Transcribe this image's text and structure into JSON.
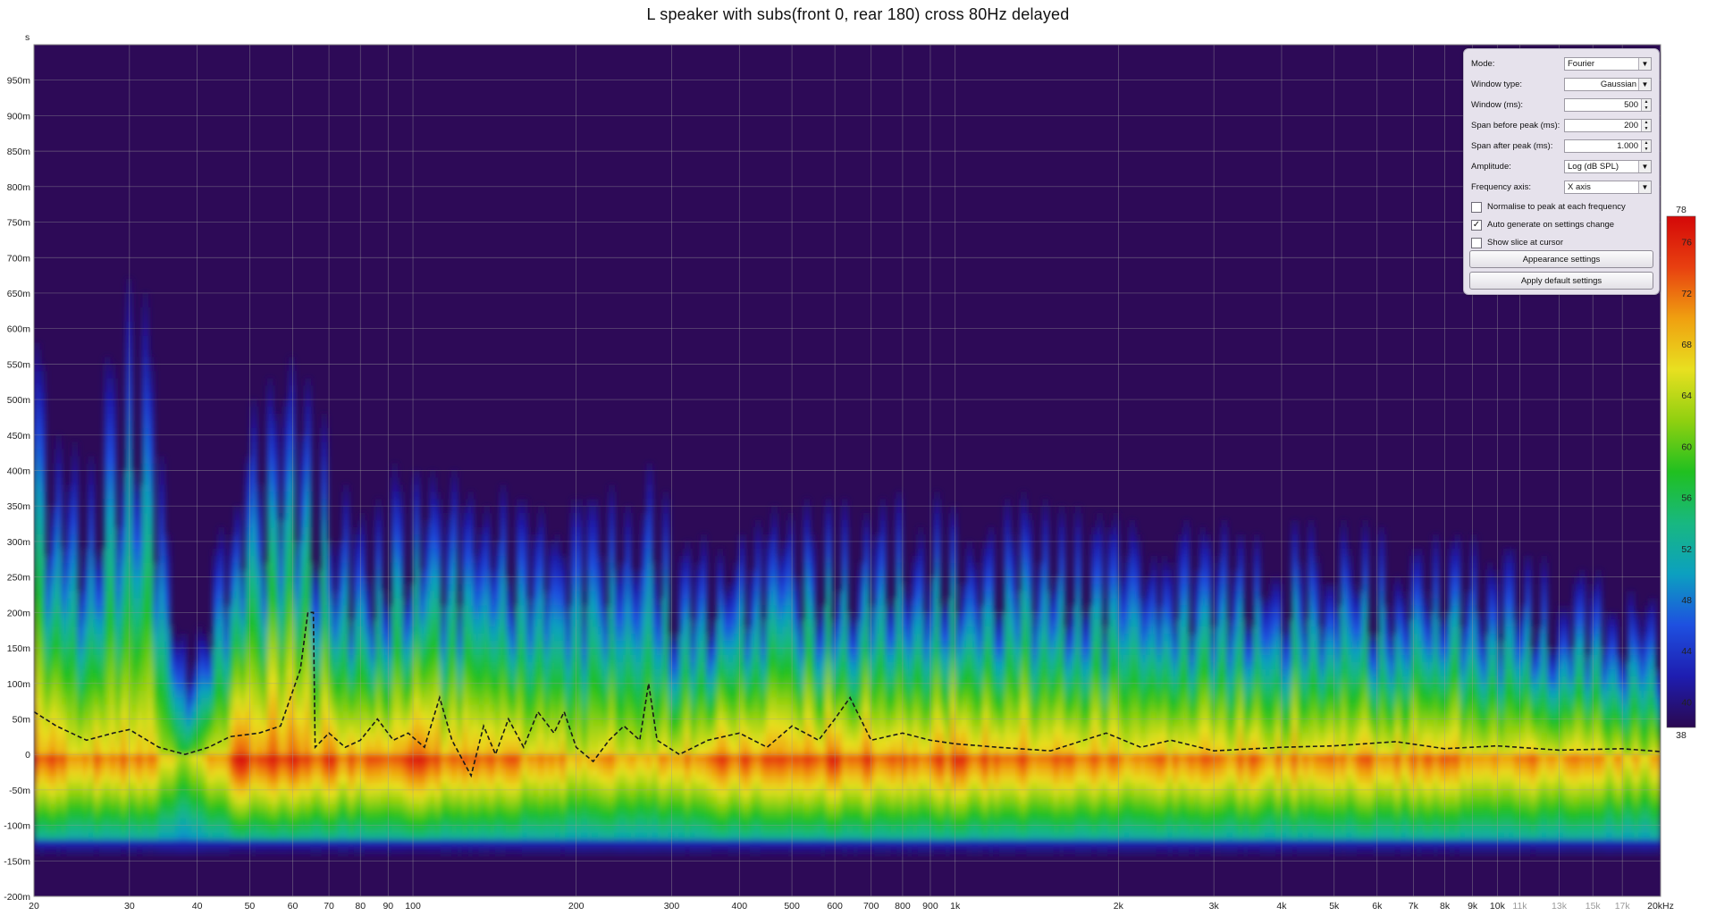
{
  "chart_data": {
    "type": "heatmap",
    "title": "L speaker with subs(front 0, rear 180) cross 80Hz delayed",
    "x_scale": "log",
    "xlim": [
      20,
      20000
    ],
    "x_ticks": [
      {
        "v": 20,
        "label": "20"
      },
      {
        "v": 30,
        "label": "30"
      },
      {
        "v": 40,
        "label": "40"
      },
      {
        "v": 50,
        "label": "50"
      },
      {
        "v": 60,
        "label": "60"
      },
      {
        "v": 70,
        "label": "70"
      },
      {
        "v": 80,
        "label": "80"
      },
      {
        "v": 90,
        "label": "90"
      },
      {
        "v": 100,
        "label": "100"
      },
      {
        "v": 200,
        "label": "200"
      },
      {
        "v": 300,
        "label": "300"
      },
      {
        "v": 400,
        "label": "400"
      },
      {
        "v": 500,
        "label": "500"
      },
      {
        "v": 600,
        "label": "600"
      },
      {
        "v": 700,
        "label": "700"
      },
      {
        "v": 800,
        "label": "800"
      },
      {
        "v": 900,
        "label": "900"
      },
      {
        "v": 1000,
        "label": "1k"
      },
      {
        "v": 2000,
        "label": "2k"
      },
      {
        "v": 3000,
        "label": "3k"
      },
      {
        "v": 4000,
        "label": "4k"
      },
      {
        "v": 5000,
        "label": "5k"
      },
      {
        "v": 6000,
        "label": "6k"
      },
      {
        "v": 7000,
        "label": "7k"
      },
      {
        "v": 8000,
        "label": "8k"
      },
      {
        "v": 9000,
        "label": "9k"
      },
      {
        "v": 10000,
        "label": "10k"
      },
      {
        "v": 11000,
        "label": "11k",
        "dim": true
      },
      {
        "v": 13000,
        "label": "13k",
        "dim": true
      },
      {
        "v": 15000,
        "label": "15k",
        "dim": true
      },
      {
        "v": 17000,
        "label": "17k",
        "dim": true
      },
      {
        "v": 20000,
        "label": "20kHz"
      }
    ],
    "ylabel": "s",
    "ylim": [
      -0.2,
      1.0
    ],
    "y_ticks": [
      {
        "v": 0.95,
        "label": "950m"
      },
      {
        "v": 0.9,
        "label": "900m"
      },
      {
        "v": 0.85,
        "label": "850m"
      },
      {
        "v": 0.8,
        "label": "800m"
      },
      {
        "v": 0.75,
        "label": "750m"
      },
      {
        "v": 0.7,
        "label": "700m"
      },
      {
        "v": 0.65,
        "label": "650m"
      },
      {
        "v": 0.6,
        "label": "600m"
      },
      {
        "v": 0.55,
        "label": "550m"
      },
      {
        "v": 0.5,
        "label": "500m"
      },
      {
        "v": 0.45,
        "label": "450m"
      },
      {
        "v": 0.4,
        "label": "400m"
      },
      {
        "v": 0.35,
        "label": "350m"
      },
      {
        "v": 0.3,
        "label": "300m"
      },
      {
        "v": 0.25,
        "label": "250m"
      },
      {
        "v": 0.2,
        "label": "200m"
      },
      {
        "v": 0.15,
        "label": "150m"
      },
      {
        "v": 0.1,
        "label": "100m"
      },
      {
        "v": 0.05,
        "label": "50m"
      },
      {
        "v": 0,
        "label": "0"
      },
      {
        "v": -0.05,
        "label": "-50m"
      },
      {
        "v": -0.1,
        "label": "-100m"
      },
      {
        "v": -0.15,
        "label": "-150m"
      },
      {
        "v": -0.2,
        "label": "-200m"
      }
    ],
    "color_scale": {
      "min": 38,
      "max": 78,
      "labels": [
        {
          "v": 78,
          "label": "78"
        },
        {
          "v": 76,
          "label": "76"
        },
        {
          "v": 72,
          "label": "72"
        },
        {
          "v": 68,
          "label": "68"
        },
        {
          "v": 64,
          "label": "64"
        },
        {
          "v": 60,
          "label": "60"
        },
        {
          "v": 56,
          "label": "56"
        },
        {
          "v": 52,
          "label": "52"
        },
        {
          "v": 48,
          "label": "48"
        },
        {
          "v": 44,
          "label": "44"
        },
        {
          "v": 40,
          "label": "40"
        },
        {
          "v": 38,
          "label": "38"
        }
      ],
      "colors": [
        "#2a0850",
        "#1e1db0",
        "#1e50e0",
        "#0ca0c0",
        "#18b880",
        "#20c020",
        "#90d010",
        "#e8e020",
        "#f0a010",
        "#e84010",
        "#d40808"
      ]
    },
    "background_color": "#2d0a57",
    "grid": true,
    "decay_envelope": [
      {
        "f": 20,
        "t": 0.55,
        "a": 70
      },
      {
        "f": 24,
        "t": 0.38,
        "a": 68
      },
      {
        "f": 31,
        "t": 0.68,
        "a": 68
      },
      {
        "f": 38,
        "t": 0.1,
        "a": 60
      },
      {
        "f": 48,
        "t": 0.45,
        "a": 72
      },
      {
        "f": 62,
        "t": 0.52,
        "a": 70
      },
      {
        "f": 78,
        "t": 0.3,
        "a": 70
      },
      {
        "f": 92,
        "t": 0.38,
        "a": 72
      },
      {
        "f": 130,
        "t": 0.36,
        "a": 68
      },
      {
        "f": 200,
        "t": 0.33,
        "a": 66
      },
      {
        "f": 280,
        "t": 0.39,
        "a": 66
      },
      {
        "f": 300,
        "t": 0.27,
        "a": 68
      },
      {
        "f": 500,
        "t": 0.32,
        "a": 70
      },
      {
        "f": 1000,
        "t": 0.35,
        "a": 70
      },
      {
        "f": 2000,
        "t": 0.3,
        "a": 68
      },
      {
        "f": 5000,
        "t": 0.3,
        "a": 68
      },
      {
        "f": 10000,
        "t": 0.27,
        "a": 68
      },
      {
        "f": 20000,
        "t": 0.2,
        "a": 64
      }
    ],
    "peak_time_curve": [
      {
        "f": 20,
        "t": 0.06
      },
      {
        "f": 22,
        "t": 0.04
      },
      {
        "f": 25,
        "t": 0.02
      },
      {
        "f": 28,
        "t": 0.03
      },
      {
        "f": 30,
        "t": 0.035
      },
      {
        "f": 34,
        "t": 0.01
      },
      {
        "f": 38,
        "t": 0
      },
      {
        "f": 42,
        "t": 0.01
      },
      {
        "f": 46,
        "t": 0.025
      },
      {
        "f": 52,
        "t": 0.03
      },
      {
        "f": 57,
        "t": 0.04
      },
      {
        "f": 62,
        "t": 0.12
      },
      {
        "f": 64,
        "t": 0.2
      },
      {
        "f": 65.5,
        "t": 0.2
      },
      {
        "f": 66,
        "t": 0.01
      },
      {
        "f": 70,
        "t": 0.03
      },
      {
        "f": 75,
        "t": 0.01
      },
      {
        "f": 80,
        "t": 0.02
      },
      {
        "f": 86,
        "t": 0.05
      },
      {
        "f": 92,
        "t": 0.02
      },
      {
        "f": 98,
        "t": 0.03
      },
      {
        "f": 105,
        "t": 0.01
      },
      {
        "f": 112,
        "t": 0.08
      },
      {
        "f": 118,
        "t": 0.02
      },
      {
        "f": 128,
        "t": -0.03
      },
      {
        "f": 135,
        "t": 0.04
      },
      {
        "f": 142,
        "t": 0.0
      },
      {
        "f": 150,
        "t": 0.05
      },
      {
        "f": 160,
        "t": 0.01
      },
      {
        "f": 170,
        "t": 0.06
      },
      {
        "f": 182,
        "t": 0.03
      },
      {
        "f": 190,
        "t": 0.06
      },
      {
        "f": 200,
        "t": 0.01
      },
      {
        "f": 215,
        "t": -0.01
      },
      {
        "f": 230,
        "t": 0.02
      },
      {
        "f": 245,
        "t": 0.04
      },
      {
        "f": 262,
        "t": 0.02
      },
      {
        "f": 272,
        "t": 0.1
      },
      {
        "f": 282,
        "t": 0.02
      },
      {
        "f": 310,
        "t": 0.0
      },
      {
        "f": 350,
        "t": 0.02
      },
      {
        "f": 400,
        "t": 0.03
      },
      {
        "f": 450,
        "t": 0.01
      },
      {
        "f": 500,
        "t": 0.04
      },
      {
        "f": 560,
        "t": 0.02
      },
      {
        "f": 600,
        "t": 0.05
      },
      {
        "f": 640,
        "t": 0.08
      },
      {
        "f": 700,
        "t": 0.02
      },
      {
        "f": 800,
        "t": 0.03
      },
      {
        "f": 900,
        "t": 0.02
      },
      {
        "f": 1000,
        "t": 0.015
      },
      {
        "f": 1200,
        "t": 0.01
      },
      {
        "f": 1500,
        "t": 0.005
      },
      {
        "f": 1900,
        "t": 0.03
      },
      {
        "f": 2200,
        "t": 0.01
      },
      {
        "f": 2500,
        "t": 0.02
      },
      {
        "f": 3000,
        "t": 0.005
      },
      {
        "f": 4000,
        "t": 0.01
      },
      {
        "f": 5000,
        "t": 0.012
      },
      {
        "f": 6500,
        "t": 0.018
      },
      {
        "f": 8000,
        "t": 0.008
      },
      {
        "f": 10000,
        "t": 0.012
      },
      {
        "f": 13000,
        "t": 0.006
      },
      {
        "f": 17000,
        "t": 0.008
      },
      {
        "f": 20000,
        "t": 0.004
      }
    ]
  },
  "panel": {
    "mode": {
      "label": "Mode:",
      "value": "Fourier"
    },
    "window_type": {
      "label": "Window type:",
      "value": "Gaussian"
    },
    "window_ms": {
      "label": "Window (ms):",
      "value": "500"
    },
    "span_before": {
      "label": "Span before peak (ms):",
      "value": "200"
    },
    "span_after": {
      "label": "Span after peak (ms):",
      "value": "1.000"
    },
    "amplitude": {
      "label": "Amplitude:",
      "value": "Log (dB SPL)"
    },
    "freq_axis": {
      "label": "Frequency axis:",
      "value": "X axis"
    },
    "normalise": {
      "label": "Normalise to peak at each frequency",
      "checked": false
    },
    "auto_generate": {
      "label": "Auto generate on settings change",
      "checked": true
    },
    "show_slice": {
      "label": "Show slice at cursor",
      "checked": false
    },
    "appearance_btn": "Appearance settings",
    "default_btn": "Apply default settings"
  },
  "glyphs": {
    "check": "✓",
    "dropdown": "▼",
    "spin_up": "▲",
    "spin_down": "▼"
  }
}
